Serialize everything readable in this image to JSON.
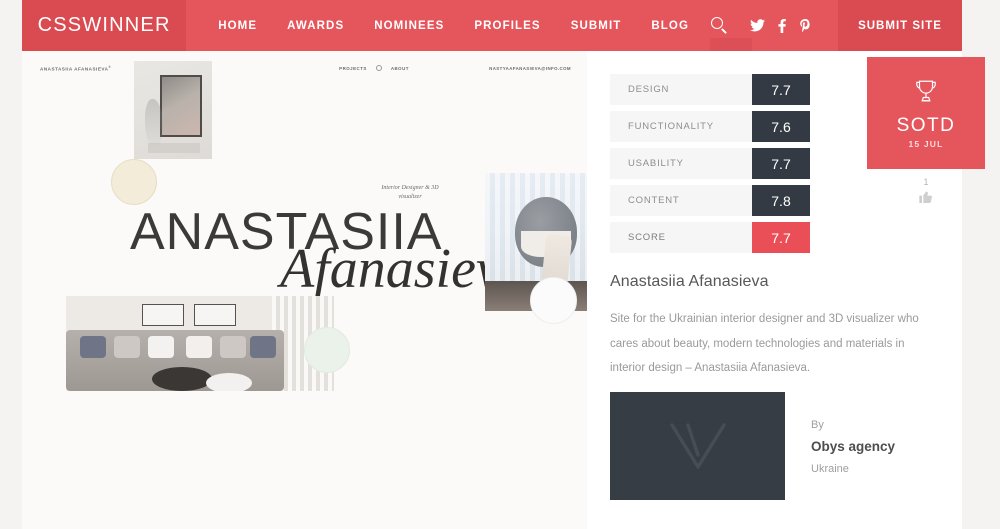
{
  "header": {
    "logo": "CSSWINNER",
    "nav": [
      {
        "label": "HOME"
      },
      {
        "label": "AWARDS"
      },
      {
        "label": "NOMINEES"
      },
      {
        "label": "PROFILES"
      },
      {
        "label": "SUBMIT"
      },
      {
        "label": "BLOG"
      }
    ],
    "search_icon": "search-icon",
    "socials": [
      {
        "name": "twitter-icon"
      },
      {
        "name": "facebook-icon"
      },
      {
        "name": "pinterest-icon"
      }
    ],
    "submit_site": "SUBMIT SITE",
    "brand_color": "#e4565c",
    "brand_color_dark": "#da4a51"
  },
  "preview": {
    "brand": "ANASTASIIA AFANASIEVA",
    "brand_sup": "®",
    "nav": [
      {
        "label": "PROJECTS"
      },
      {
        "label": "ABOUT"
      }
    ],
    "email": "NASTYAAFANASIEVA@INFO.COM",
    "title": "ANASTASIIA",
    "script": "Afanasieva",
    "subtitle": "Interior Designer & 3D visualizer"
  },
  "ratings": {
    "rows": [
      {
        "label": "DESIGN",
        "value": "7.7"
      },
      {
        "label": "FUNCTIONALITY",
        "value": "7.6"
      },
      {
        "label": "USABILITY",
        "value": "7.7"
      },
      {
        "label": "CONTENT",
        "value": "7.8"
      }
    ],
    "score": {
      "label": "SCORE",
      "value": "7.7"
    },
    "value_bg": "#343a43",
    "score_bg": "#ea4f58"
  },
  "award": {
    "icon": "trophy-icon",
    "title": "SOTD",
    "date": "15 JUL",
    "badge_color": "#e4565c"
  },
  "likes": {
    "count": "1",
    "icon": "thumbs-up-icon"
  },
  "site": {
    "title": "Anastasiia Afanasieva",
    "description": "Site for the Ukrainian interior designer and 3D visualizer who cares about beauty, modern technologies and materials in interior design – Anastasiia Afanasieva."
  },
  "agency": {
    "logo_alt": "obys-agency-logo",
    "by_label": "By",
    "name": "Obys agency",
    "country": "Ukraine",
    "logo_bg": "#373d45"
  }
}
